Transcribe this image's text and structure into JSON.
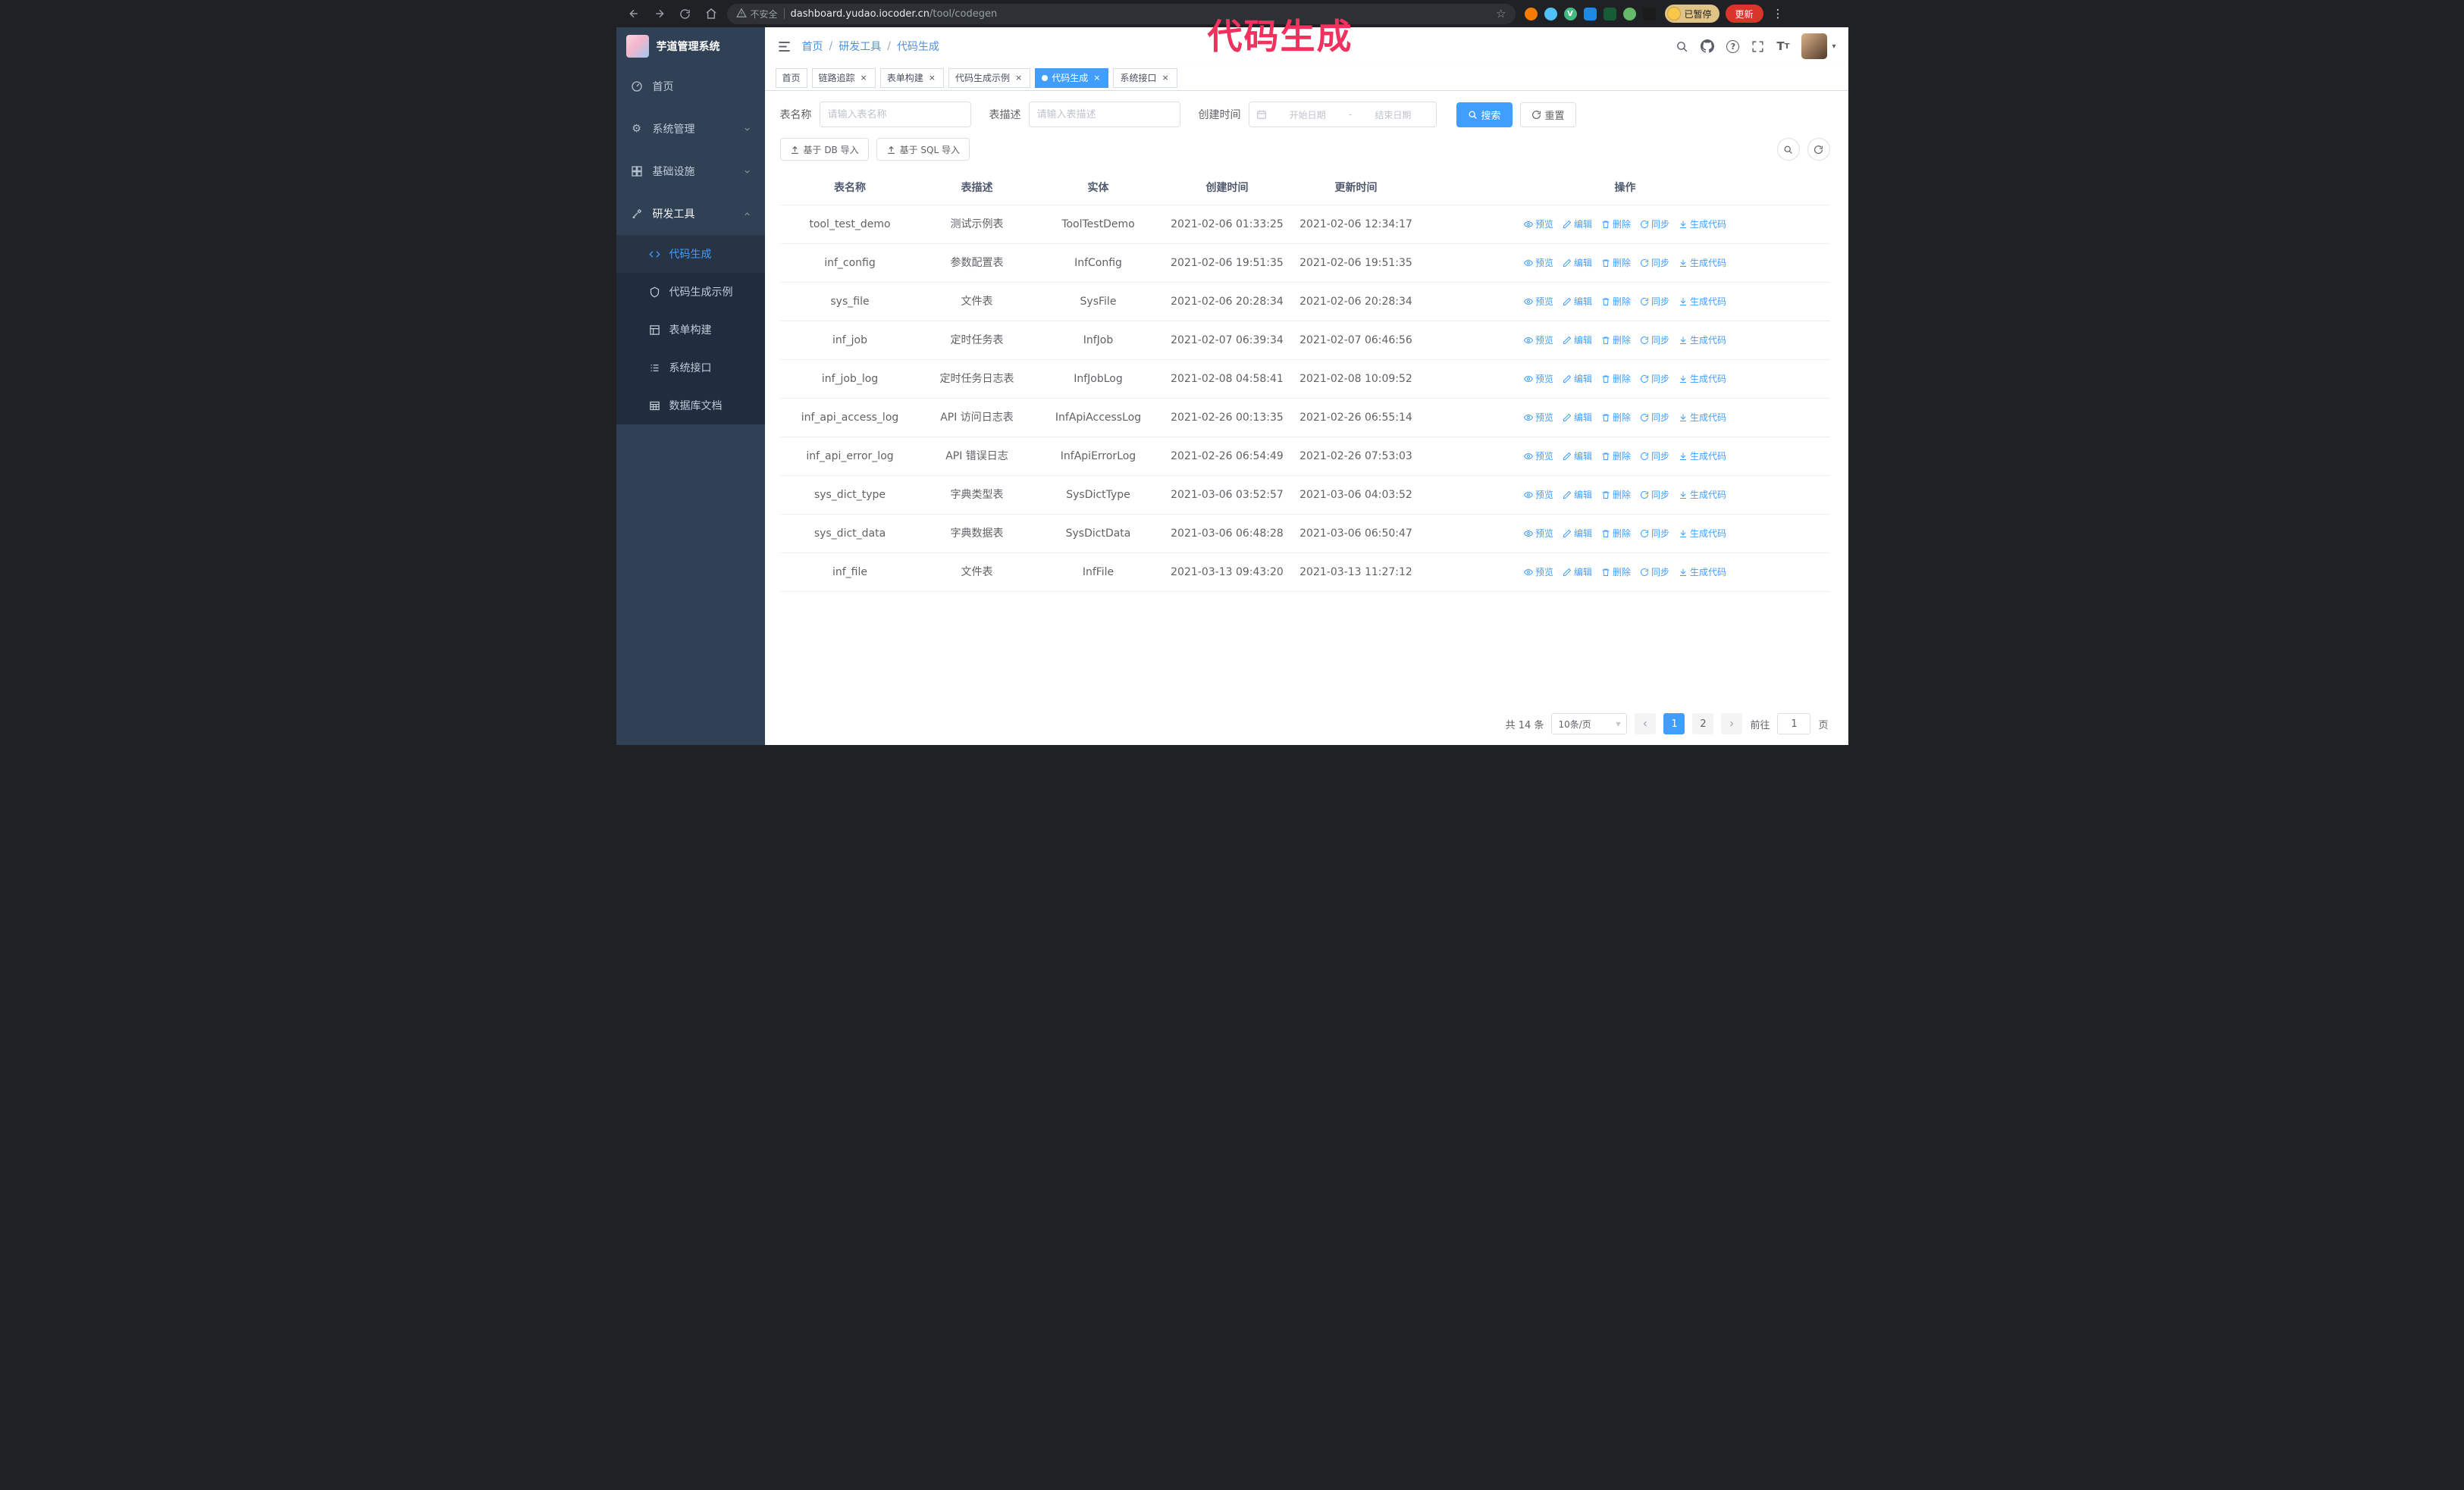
{
  "browser": {
    "security_label": "不安全",
    "url_host": "dashboard.yudao.iocoder.cn",
    "url_path": "/tool/codegen",
    "paused_badge": "已暂停",
    "update_button": "更新"
  },
  "annotation": {
    "text": "代码生成",
    "color": "#f2315e"
  },
  "sidebar": {
    "logo_title": "芋道管理系统",
    "items": [
      {
        "label": "首页"
      },
      {
        "label": "系统管理"
      },
      {
        "label": "基础设施"
      },
      {
        "label": "研发工具"
      }
    ],
    "sub_items": [
      {
        "label": "代码生成",
        "active": true
      },
      {
        "label": "代码生成示例"
      },
      {
        "label": "表单构建"
      },
      {
        "label": "系统接口"
      },
      {
        "label": "数据库文档"
      }
    ]
  },
  "header": {
    "breadcrumb": [
      {
        "label": "首页"
      },
      {
        "label": "研发工具"
      },
      {
        "label": "代码生成"
      }
    ]
  },
  "tabs": [
    {
      "label": "首页"
    },
    {
      "label": "链路追踪"
    },
    {
      "label": "表单构建"
    },
    {
      "label": "代码生成示例"
    },
    {
      "label": "代码生成",
      "active": true
    },
    {
      "label": "系统接口"
    }
  ],
  "filters": {
    "table_name_label": "表名称",
    "table_name_placeholder": "请输入表名称",
    "table_desc_label": "表描述",
    "table_desc_placeholder": "请输入表描述",
    "create_time_label": "创建时间",
    "date_start_placeholder": "开始日期",
    "date_separator": "-",
    "date_end_placeholder": "结束日期",
    "search_button": "搜索",
    "reset_button": "重置"
  },
  "toolbar": {
    "import_db": "基于 DB 导入",
    "import_sql": "基于 SQL 导入"
  },
  "table": {
    "columns": [
      "表名称",
      "表描述",
      "实体",
      "创建时间",
      "更新时间",
      "操作"
    ],
    "actions": [
      "预览",
      "编辑",
      "删除",
      "同步",
      "生成代码"
    ],
    "rows": [
      {
        "name": "tool_test_demo",
        "desc": "测试示例表",
        "entity": "ToolTestDemo",
        "created": "2021-02-06 01:33:25",
        "updated": "2021-02-06 12:34:17"
      },
      {
        "name": "inf_config",
        "desc": "参数配置表",
        "entity": "InfConfig",
        "created": "2021-02-06 19:51:35",
        "updated": "2021-02-06 19:51:35"
      },
      {
        "name": "sys_file",
        "desc": "文件表",
        "entity": "SysFile",
        "created": "2021-02-06 20:28:34",
        "updated": "2021-02-06 20:28:34"
      },
      {
        "name": "inf_job",
        "desc": "定时任务表",
        "entity": "InfJob",
        "created": "2021-02-07 06:39:34",
        "updated": "2021-02-07 06:46:56"
      },
      {
        "name": "inf_job_log",
        "desc": "定时任务日志表",
        "entity": "InfJobLog",
        "created": "2021-02-08 04:58:41",
        "updated": "2021-02-08 10:09:52"
      },
      {
        "name": "inf_api_access_log",
        "desc": "API 访问日志表",
        "entity": "InfApiAccessLog",
        "created": "2021-02-26 00:13:35",
        "updated": "2021-02-26 06:55:14"
      },
      {
        "name": "inf_api_error_log",
        "desc": "API 错误日志",
        "entity": "InfApiErrorLog",
        "created": "2021-02-26 06:54:49",
        "updated": "2021-02-26 07:53:03"
      },
      {
        "name": "sys_dict_type",
        "desc": "字典类型表",
        "entity": "SysDictType",
        "created": "2021-03-06 03:52:57",
        "updated": "2021-03-06 04:03:52"
      },
      {
        "name": "sys_dict_data",
        "desc": "字典数据表",
        "entity": "SysDictData",
        "created": "2021-03-06 06:48:28",
        "updated": "2021-03-06 06:50:47"
      },
      {
        "name": "inf_file",
        "desc": "文件表",
        "entity": "InfFile",
        "created": "2021-03-13 09:43:20",
        "updated": "2021-03-13 11:27:12"
      }
    ]
  },
  "pagination": {
    "total": "共 14 条",
    "page_size": "10条/页",
    "pages": [
      "1",
      "2"
    ],
    "goto_label": "前往",
    "goto_value": "1",
    "goto_suffix": "页"
  },
  "colors": {
    "primary": "#409eff",
    "sidebar_bg": "#304156",
    "submenu_bg": "#1f2d3d",
    "annotation": "#f2315e",
    "update_button_bg": "#d9352a",
    "paused_badge_bg": "#dfc387"
  }
}
